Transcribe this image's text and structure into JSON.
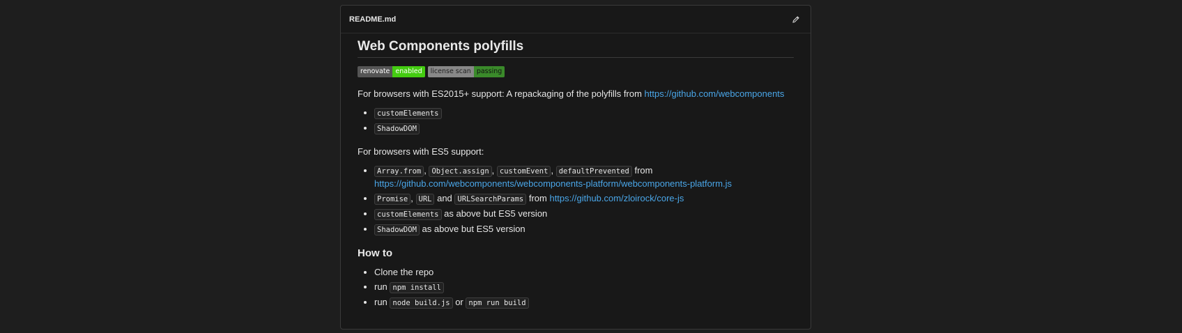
{
  "file": {
    "name": "README.md"
  },
  "title": "Web Components polyfills",
  "badges": [
    {
      "label": "renovate",
      "value": "enabled"
    },
    {
      "label": "license scan",
      "value": "passing"
    }
  ],
  "p1": {
    "text": "For browsers with ES2015+ support: A repackaging of the polyfills from ",
    "link": "https://github.com/webcomponents"
  },
  "list1": [
    "customElements",
    "ShadowDOM"
  ],
  "p2": "For browsers with ES5 support:",
  "list2": {
    "item1": {
      "codes": [
        "Array.from",
        "Object.assign",
        "customEvent",
        "defaultPrevented"
      ],
      "sep": ",",
      "suffix": " from",
      "link": "https://github.com/webcomponents/webcomponents-platform/webcomponents-platform.js"
    },
    "item2": {
      "code1": "Promise",
      "sep": ",",
      "code2": "URL",
      "and": " and ",
      "code3": "URLSearchParams",
      "from": " from ",
      "link": "https://github.com/zloirock/core-js"
    },
    "item3": {
      "code": "customElements",
      "text": " as above but ES5 version"
    },
    "item4": {
      "code": "ShadowDOM",
      "text": " as above but ES5 version"
    }
  },
  "howto": {
    "heading": "How to",
    "item1": "Clone the repo",
    "item2": {
      "text": "run ",
      "code": "npm install"
    },
    "item3": {
      "text": "run ",
      "code1": "node build.js",
      "or": " or ",
      "code2": "npm run build"
    }
  }
}
